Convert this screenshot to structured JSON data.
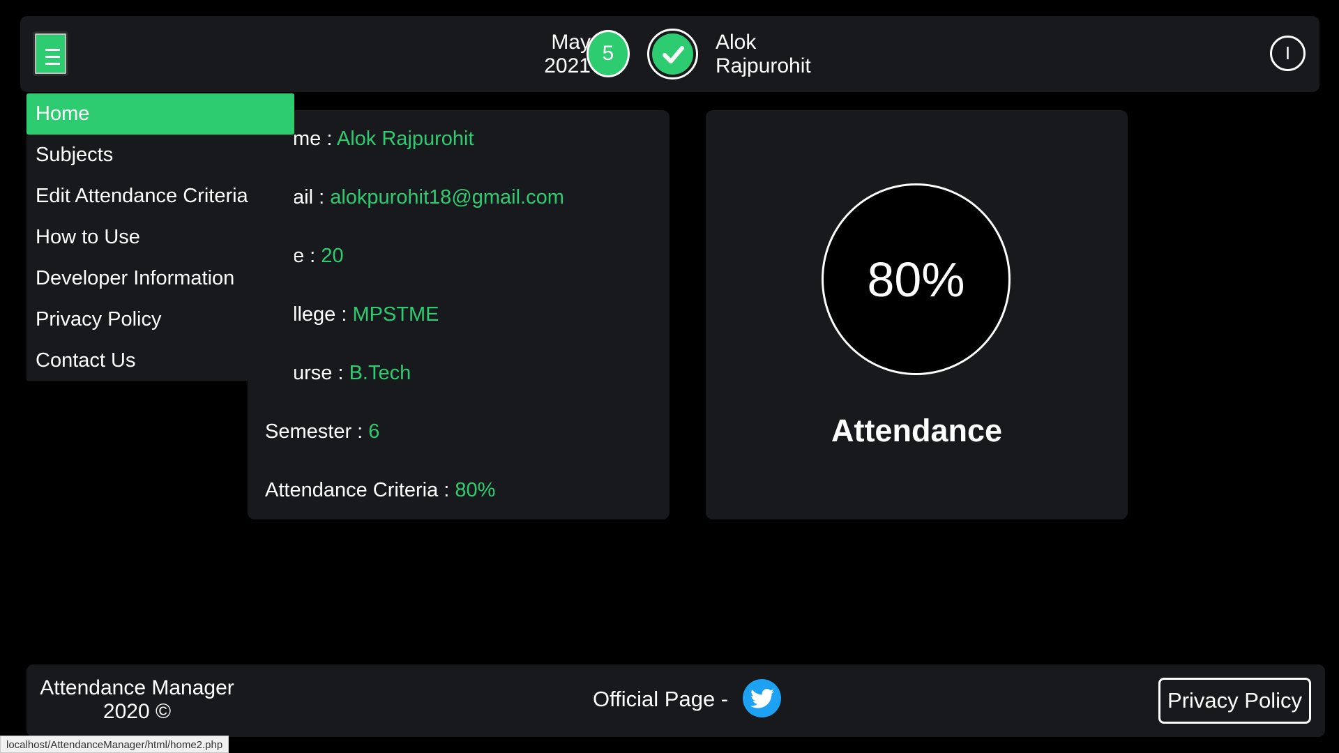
{
  "header": {
    "menu_icon": "hamburger-icon",
    "month": "May",
    "year": "2021",
    "day": "5",
    "check_icon": "checkmark-icon",
    "user_first": "Alok",
    "user_last": "Rajpurohit",
    "power_label": "I"
  },
  "sidemenu": {
    "items": [
      {
        "label": "Home",
        "active": true
      },
      {
        "label": "Subjects"
      },
      {
        "label": "Edit Attendance Criteria"
      },
      {
        "label": "How to Use"
      },
      {
        "label": "Developer Information"
      },
      {
        "label": "Privacy Policy"
      },
      {
        "label": "Contact Us"
      }
    ]
  },
  "profile": {
    "rows": [
      {
        "label": "me : ",
        "value": "Alok Rajpurohit"
      },
      {
        "label": "ail : ",
        "value": "alokpurohit18@gmail.com"
      },
      {
        "label": "e : ",
        "value": "20"
      },
      {
        "label": "llege : ",
        "value": "MPSTME"
      },
      {
        "label": "urse : ",
        "value": "B.Tech"
      },
      {
        "label": "Semester : ",
        "value": "6"
      },
      {
        "label": "Attendance Criteria : ",
        "value": "80%"
      }
    ]
  },
  "attendance": {
    "percent": "80%",
    "label": "Attendance"
  },
  "footer": {
    "copyright_line1": "Attendance Manager",
    "copyright_line2": "2020 ©",
    "official": "Official Page -",
    "twitter_icon": "twitter-icon",
    "privacy": "Privacy Policy"
  },
  "status_url": "localhost/AttendanceManager/html/home2.php",
  "colors": {
    "accent": "#2ecc71",
    "panel": "#18191d",
    "background": "#000000",
    "twitter": "#1da1f2"
  }
}
